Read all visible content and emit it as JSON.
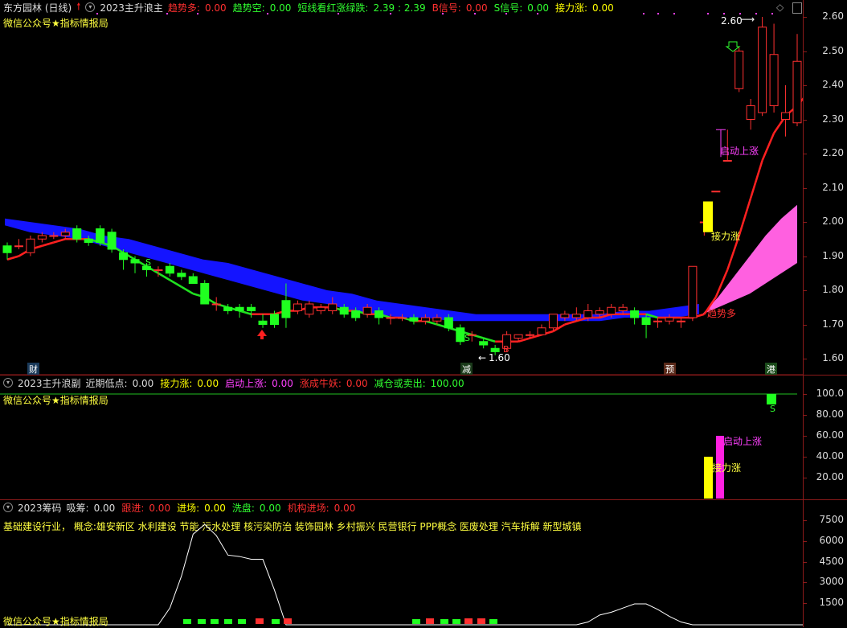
{
  "panel1": {
    "stock": "东方园林 (日线)",
    "indicator": "2023主升浪主",
    "fields": [
      {
        "label": "趋势多:",
        "value": "0.00",
        "color": "#ff3030"
      },
      {
        "label": "趋势空:",
        "value": "0.00",
        "color": "#30ff30"
      },
      {
        "label": "短线看红涨绿跌:",
        "value": "2.39 : 2.39",
        "color": "#30ff30"
      },
      {
        "label": "B信号:",
        "value": "0.00",
        "color": "#ff3030"
      },
      {
        "label": "S信号:",
        "value": "0.00",
        "color": "#30ff30"
      },
      {
        "label": "接力涨:",
        "value": "0.00",
        "color": "#ffff00"
      }
    ],
    "subtitle": "微信公众号★指标情报局",
    "yticks": [
      "2.60",
      "2.50",
      "2.40",
      "2.30",
      "2.20",
      "2.10",
      "2.00",
      "1.90",
      "1.80",
      "1.70",
      "1.60"
    ],
    "annotations": {
      "high": "2.60",
      "low": "1.60",
      "start_rise": "启动上涨",
      "relay": "接力涨",
      "trend_up": "趋势多",
      "s1": "S",
      "s2": "S",
      "b": "B"
    },
    "markers": [
      "财",
      "减",
      "预",
      "港"
    ]
  },
  "panel2": {
    "indicator": "2023主升浪副",
    "fields": [
      {
        "label": "近期低点:",
        "value": "0.00",
        "color": "#dddddd"
      },
      {
        "label": "接力涨:",
        "value": "0.00",
        "color": "#ffff00"
      },
      {
        "label": "启动上涨:",
        "value": "0.00",
        "color": "#ff40ff"
      },
      {
        "label": "涨成牛妖:",
        "value": "0.00",
        "color": "#ff3030"
      },
      {
        "label": "减仓或卖出:",
        "value": "100.00",
        "color": "#30ff30"
      }
    ],
    "subtitle": "微信公众号★指标情报局",
    "yticks": [
      "100.0",
      "80.00",
      "60.00",
      "40.00",
      "20.00"
    ],
    "annotations": {
      "start_rise": "启动上涨",
      "relay": "接力涨",
      "s": "S"
    }
  },
  "panel3": {
    "indicator": "2023筹码",
    "fields": [
      {
        "label": "吸筹:",
        "value": "0.00",
        "color": "#dddddd"
      },
      {
        "label": "跟进:",
        "value": "0.00",
        "color": "#ff3030"
      },
      {
        "label": "进场:",
        "value": "0.00",
        "color": "#ffff00"
      },
      {
        "label": "洗盘:",
        "value": "0.00",
        "color": "#30ff30"
      },
      {
        "label": "机构进场:",
        "value": "0.00",
        "color": "#ff3030"
      }
    ],
    "concepts": "基础建设行业，  概念:雄安新区 水利建设 节能 污水处理 核污染防治 装饰园林 乡村振兴 民营银行 PPP概念 医废处理 汽车拆解 新型城镇",
    "subtitle": "微信公众号★指标情报局",
    "yticks": [
      "7500",
      "6000",
      "4500",
      "3000",
      "1500"
    ]
  },
  "candles": [
    [
      1.93,
      1.91,
      1.94,
      1.89
    ],
    [
      1.93,
      1.93,
      1.95,
      1.92
    ],
    [
      1.91,
      1.95,
      1.96,
      1.9
    ],
    [
      1.95,
      1.96,
      1.97,
      1.94
    ],
    [
      1.96,
      1.96,
      1.97,
      1.95
    ],
    [
      1.96,
      1.97,
      1.98,
      1.95
    ],
    [
      1.98,
      1.95,
      1.99,
      1.94
    ],
    [
      1.95,
      1.94,
      1.96,
      1.93
    ],
    [
      1.98,
      1.94,
      1.99,
      1.93
    ],
    [
      1.97,
      1.92,
      1.98,
      1.91
    ],
    [
      1.91,
      1.89,
      1.92,
      1.86
    ],
    [
      1.89,
      1.88,
      1.9,
      1.85
    ],
    [
      1.87,
      1.86,
      1.88,
      1.84
    ],
    [
      1.86,
      1.86,
      1.87,
      1.84
    ],
    [
      1.87,
      1.85,
      1.88,
      1.84
    ],
    [
      1.85,
      1.84,
      1.86,
      1.83
    ],
    [
      1.84,
      1.82,
      1.85,
      1.82
    ],
    [
      1.82,
      1.76,
      1.83,
      1.76
    ],
    [
      1.76,
      1.76,
      1.78,
      1.74
    ],
    [
      1.75,
      1.74,
      1.76,
      1.73
    ],
    [
      1.75,
      1.74,
      1.76,
      1.72
    ],
    [
      1.75,
      1.74,
      1.76,
      1.72
    ],
    [
      1.71,
      1.7,
      1.73,
      1.69
    ],
    [
      1.73,
      1.7,
      1.74,
      1.69
    ],
    [
      1.77,
      1.72,
      1.82,
      1.69
    ],
    [
      1.74,
      1.76,
      1.77,
      1.73
    ],
    [
      1.73,
      1.76,
      1.77,
      1.72
    ],
    [
      1.74,
      1.75,
      1.76,
      1.73
    ],
    [
      1.74,
      1.76,
      1.78,
      1.73
    ],
    [
      1.75,
      1.73,
      1.76,
      1.72
    ],
    [
      1.74,
      1.72,
      1.75,
      1.71
    ],
    [
      1.73,
      1.75,
      1.76,
      1.72
    ],
    [
      1.74,
      1.72,
      1.75,
      1.7
    ],
    [
      1.72,
      1.72,
      1.73,
      1.7
    ],
    [
      1.72,
      1.72,
      1.73,
      1.71
    ],
    [
      1.72,
      1.71,
      1.73,
      1.7
    ],
    [
      1.71,
      1.72,
      1.73,
      1.7
    ],
    [
      1.71,
      1.72,
      1.73,
      1.7
    ],
    [
      1.72,
      1.69,
      1.73,
      1.68
    ],
    [
      1.69,
      1.65,
      1.7,
      1.64
    ],
    [
      1.67,
      1.67,
      1.68,
      1.65
    ],
    [
      1.65,
      1.64,
      1.66,
      1.63
    ],
    [
      1.63,
      1.62,
      1.64,
      1.61
    ],
    [
      1.63,
      1.67,
      1.68,
      1.62
    ],
    [
      1.66,
      1.67,
      1.67,
      1.65
    ],
    [
      1.67,
      1.67,
      1.68,
      1.66
    ],
    [
      1.67,
      1.69,
      1.7,
      1.67
    ],
    [
      1.69,
      1.73,
      1.73,
      1.68
    ],
    [
      1.72,
      1.73,
      1.74,
      1.71
    ],
    [
      1.72,
      1.73,
      1.75,
      1.71
    ],
    [
      1.72,
      1.74,
      1.76,
      1.71
    ],
    [
      1.73,
      1.74,
      1.75,
      1.72
    ],
    [
      1.73,
      1.75,
      1.76,
      1.72
    ],
    [
      1.74,
      1.75,
      1.76,
      1.73
    ],
    [
      1.74,
      1.72,
      1.75,
      1.7
    ],
    [
      1.72,
      1.7,
      1.73,
      1.66
    ],
    [
      1.71,
      1.71,
      1.72,
      1.69
    ],
    [
      1.71,
      1.72,
      1.73,
      1.7
    ],
    [
      1.71,
      1.71,
      1.72,
      1.69
    ],
    [
      1.72,
      1.87,
      1.87,
      1.71
    ],
    [
      2.0,
      2.0,
      2.0,
      1.96
    ],
    [
      2.09,
      2.09,
      2.09,
      2.09
    ],
    [
      2.18,
      2.18,
      2.27,
      2.18
    ],
    [
      2.39,
      2.5,
      2.51,
      2.38
    ],
    [
      2.3,
      2.34,
      2.36,
      2.27
    ],
    [
      2.32,
      2.57,
      2.6,
      2.31
    ],
    [
      2.34,
      2.49,
      2.58,
      2.32
    ],
    [
      2.3,
      2.32,
      2.4,
      2.25
    ],
    [
      2.29,
      2.47,
      2.55,
      2.28
    ]
  ],
  "ribbon_top": [
    2.01,
    2.0,
    1.99,
    1.98,
    1.96,
    1.95,
    1.93,
    1.91,
    1.89,
    1.88,
    1.86,
    1.84,
    1.82,
    1.8,
    1.79,
    1.77,
    1.76,
    1.75,
    1.74,
    1.73,
    1.73,
    1.73,
    1.73,
    1.73,
    1.73,
    1.74,
    1.74,
    1.75,
    1.76
  ],
  "ribbon_bot": [
    1.99,
    1.97,
    1.96,
    1.95,
    1.93,
    1.91,
    1.89,
    1.87,
    1.85,
    1.83,
    1.81,
    1.79,
    1.77,
    1.76,
    1.74,
    1.73,
    1.72,
    1.72,
    1.71,
    1.71,
    1.71,
    1.71,
    1.71,
    1.71,
    1.71,
    1.72,
    1.72,
    1.72,
    1.73
  ],
  "pink_top": [
    1.73,
    1.78,
    1.84,
    1.9,
    1.96,
    2.01,
    2.05
  ],
  "pink_bot": [
    1.73,
    1.75,
    1.77,
    1.79,
    1.82,
    1.85,
    1.88
  ],
  "ma_line": [
    1.89,
    1.9,
    1.92,
    1.93,
    1.94,
    1.95,
    1.95,
    1.95,
    1.94,
    1.93,
    1.91,
    1.89,
    1.87,
    1.85,
    1.83,
    1.81,
    1.79,
    1.78,
    1.76,
    1.75,
    1.74,
    1.73,
    1.73,
    1.73,
    1.74,
    1.74,
    1.75,
    1.75,
    1.75,
    1.74,
    1.74,
    1.73,
    1.73,
    1.72,
    1.72,
    1.71,
    1.71,
    1.7,
    1.69,
    1.68,
    1.67,
    1.66,
    1.65,
    1.65,
    1.65,
    1.66,
    1.67,
    1.68,
    1.7,
    1.71,
    1.72,
    1.72,
    1.73,
    1.73,
    1.73,
    1.73,
    1.72,
    1.72,
    1.72,
    1.72,
    1.73,
    1.78,
    1.86,
    1.96,
    2.07,
    2.18,
    2.26,
    2.31,
    2.34,
    2.38
  ],
  "volume_line": [
    0,
    0,
    0,
    0,
    0,
    0,
    0,
    0,
    0,
    0,
    0,
    0,
    0,
    0,
    1200,
    3500,
    6500,
    7200,
    6400,
    5000,
    4900,
    4700,
    4700,
    2500,
    0,
    0,
    0,
    0,
    0,
    0,
    0,
    0,
    0,
    0,
    0,
    0,
    0,
    0,
    0,
    0,
    0,
    0,
    0,
    0,
    0,
    0,
    0,
    0,
    0,
    0,
    200,
    700,
    900,
    1200,
    1500,
    1500,
    1100,
    600,
    200,
    0,
    0,
    0,
    0,
    0,
    0,
    0,
    0,
    0,
    0,
    0
  ]
}
